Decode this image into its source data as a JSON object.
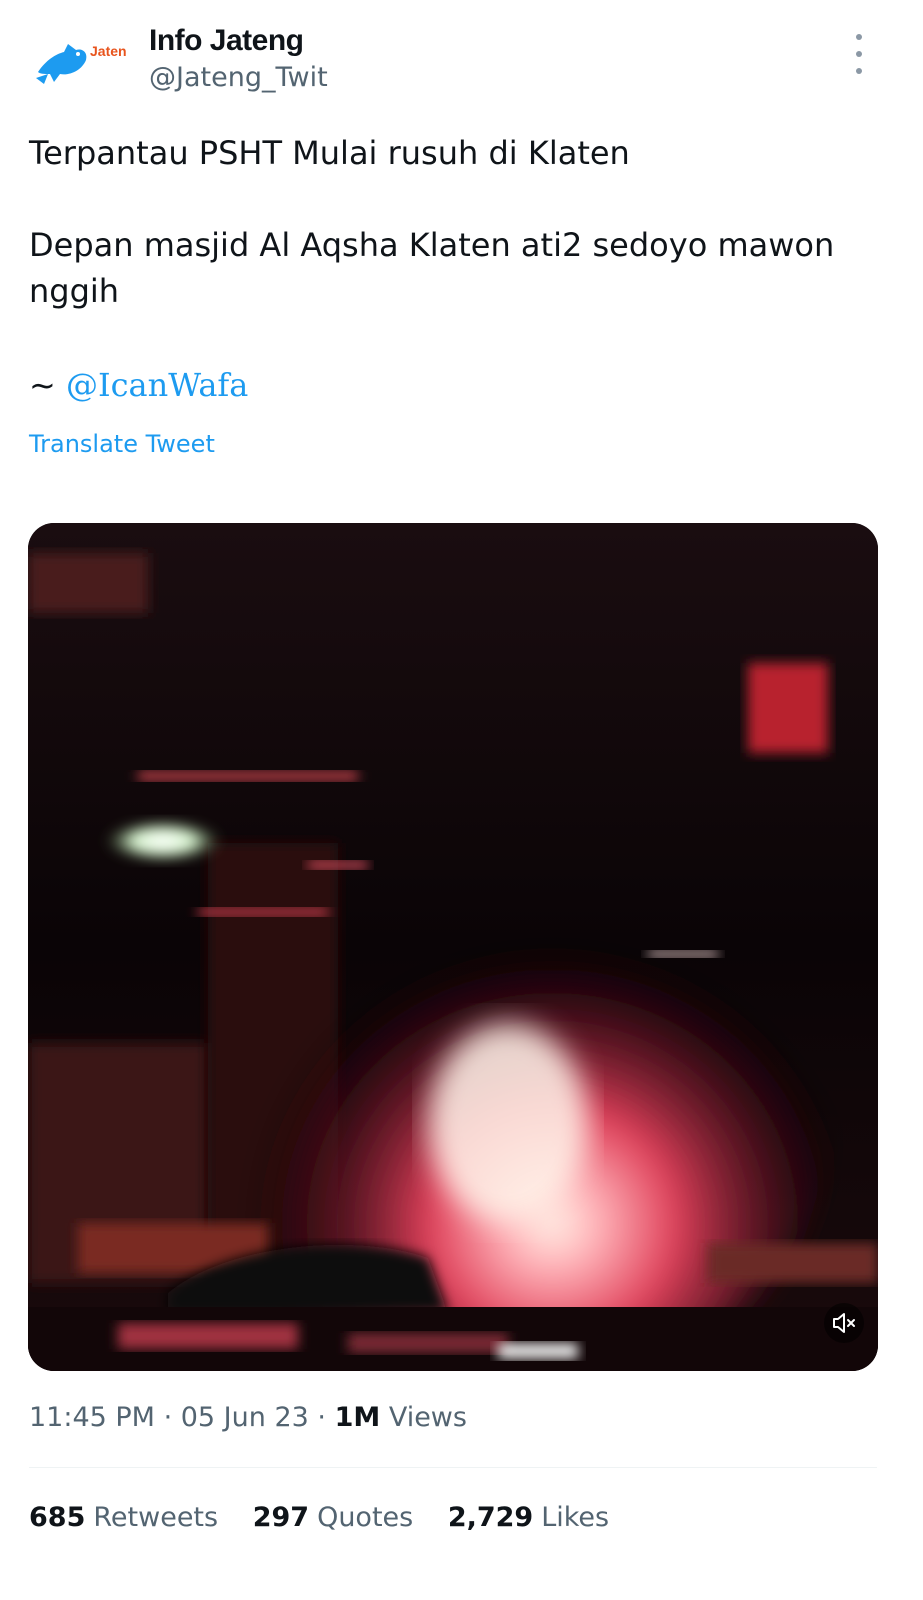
{
  "author": {
    "display_name": "Info Jateng",
    "handle": "@Jateng_Twit",
    "avatar_text": "Jateng"
  },
  "tweet": {
    "line1": "Terpantau PSHT Mulai rusuh di Klaten",
    "line2": "Depan masjid Al Aqsha Klaten ati2 sedoyo mawon nggih",
    "credit_prefix": "~ ",
    "mention": "@IcanWafa",
    "translate_label": "Translate Tweet"
  },
  "meta": {
    "time": "11:45 PM",
    "separator": " · ",
    "date": "05 Jun 23",
    "views_count": "1M",
    "views_label": "Views"
  },
  "stats": {
    "retweets_count": "685",
    "retweets_label": "Retweets",
    "quotes_count": "297",
    "quotes_label": "Quotes",
    "likes_count": "2,729",
    "likes_label": "Likes"
  },
  "colors": {
    "accent": "#1d9bf0",
    "text": "#0f1419",
    "secondary": "#536471"
  },
  "icons": [
    "bird-logo-icon",
    "more-vertical-icon",
    "volume-muted-icon"
  ]
}
